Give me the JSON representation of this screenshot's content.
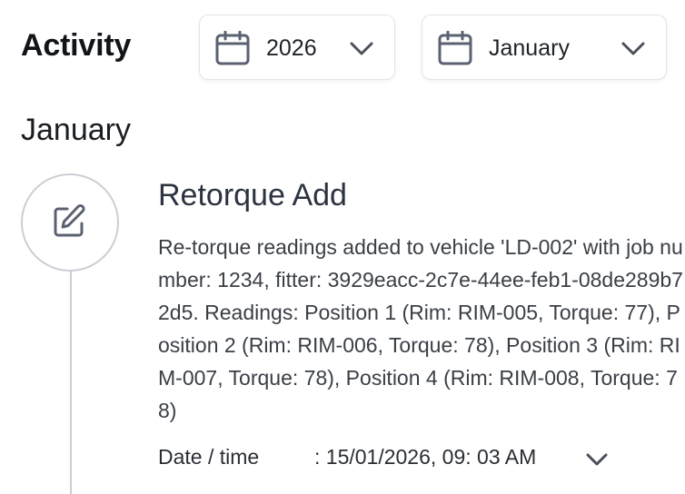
{
  "header": {
    "title": "Activity",
    "year_select": {
      "value": "2026",
      "icon": "calendar-icon"
    },
    "month_select": {
      "value": "January",
      "icon": "calendar-icon"
    }
  },
  "section": {
    "heading": "January"
  },
  "events": [
    {
      "icon": "edit-icon",
      "title": "Retorque Add",
      "description": "Re-torque readings added to vehicle 'LD-002' with job number: 1234, fitter: 3929eacc-2c7e-44ee-feb1-08de289b72d5. Readings: Position 1 (Rim: RIM-005, Torque: 77), Position 2 (Rim: RIM-006, Torque: 78), Position 3 (Rim: RIM-007, Torque: 78), Position 4 (Rim: RIM-008, Torque: 78)",
      "datetime_label": "Date / time",
      "datetime_value": ": 15/01/2026, 09: 03 AM"
    }
  ],
  "colors": {
    "text": "#1f2328",
    "border": "#e3e5e8",
    "timeline": "#cbced3",
    "icon": "#5a6170"
  }
}
